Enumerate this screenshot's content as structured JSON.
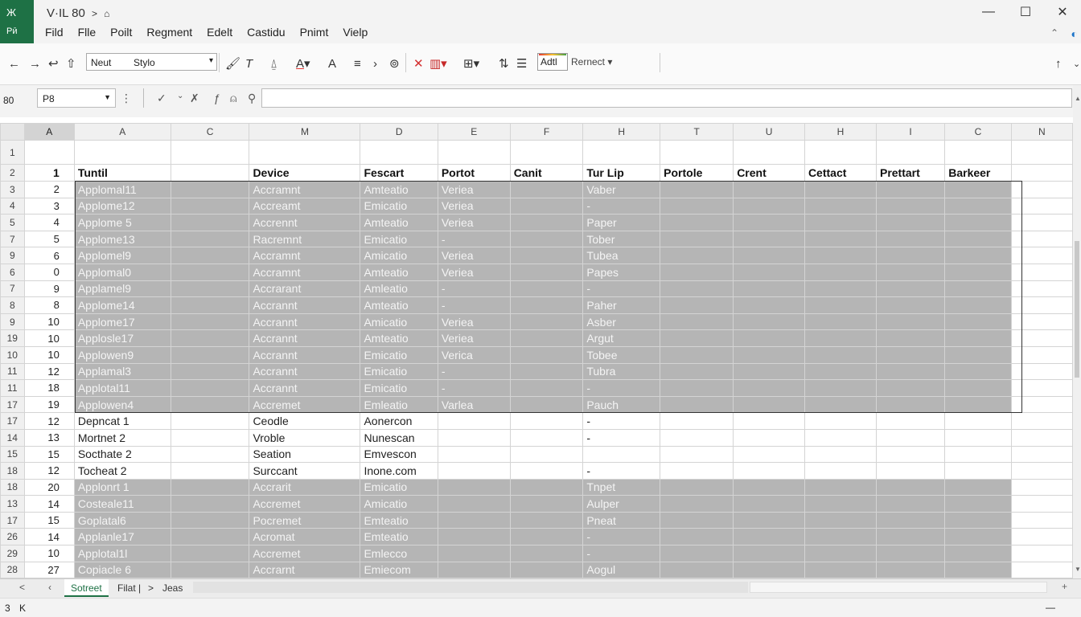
{
  "app": {
    "badge_top": "Ж",
    "badge_bottom": "Рӣ",
    "title": "V·IL 80",
    "title_sep": ">",
    "title_icon": "house-icon"
  },
  "menu": [
    "Fild",
    "Flle",
    "Poilt",
    "Regment",
    "Edelt",
    "Castidu",
    "Pnimt",
    "Vielp"
  ],
  "window_controls": {
    "minimize": "—",
    "maximize": "☐",
    "close": "✕"
  },
  "toolbar": {
    "font_name": "Neut",
    "font_style": "Stylo",
    "style_label": "Adtl",
    "refresh_label": "Rernect"
  },
  "formula_bar": {
    "left_label": "80",
    "name_box": "P8",
    "fx": "ƒ",
    "accept": "✓",
    "cancel": "✗"
  },
  "columns": [
    "A",
    "A",
    "C",
    "M",
    "D",
    "E",
    "F",
    "H",
    "T",
    "U",
    "H",
    "I",
    "C",
    "N"
  ],
  "header_row": {
    "row_label": "2",
    "num": "1",
    "b": "Tuntil",
    "c": "",
    "d": "Device",
    "e": "Fescart",
    "f": "Portot",
    "g": "Canit",
    "h": "Tur Lip",
    "i": "Portole",
    "j": "Crent",
    "k": "Cettact",
    "l": "Prettart",
    "m": "Barkeer"
  },
  "first_row_label": "1",
  "rows": [
    {
      "rl": "3",
      "n": "2",
      "b": "Applomal11",
      "d": "Accramnt",
      "e": "Amteatio",
      "f": "Veriea",
      "h": "Vaber",
      "style": "dark"
    },
    {
      "rl": "4",
      "n": "3",
      "b": "Applome12",
      "d": "Accreamt",
      "e": "Emicatio",
      "f": "Veriea",
      "h": "-",
      "style": "dark"
    },
    {
      "rl": "5",
      "n": "4",
      "b": "Applome 5",
      "d": "Accrennt",
      "e": "Amteatio",
      "f": "Veriea",
      "h": "Paper",
      "style": "dark"
    },
    {
      "rl": "7",
      "n": "5",
      "b": "Applome13",
      "d": "Racremnt",
      "e": "Emicatio",
      "f": "-",
      "h": "Tober",
      "style": "dark"
    },
    {
      "rl": "9",
      "n": "6",
      "b": "Applomel9",
      "d": "Accramnt",
      "e": "Amicatio",
      "f": "Veriea",
      "h": "Tubea",
      "style": "dark"
    },
    {
      "rl": "6",
      "n": "0",
      "b": "Applomal0",
      "d": "Accramnt",
      "e": "Amteatio",
      "f": "Veriea",
      "h": "Papes",
      "style": "dark"
    },
    {
      "rl": "7",
      "n": "9",
      "b": "Applamel9",
      "d": "Accrarant",
      "e": "Amleatio",
      "f": "-",
      "h": "-",
      "style": "dark"
    },
    {
      "rl": "8",
      "n": "8",
      "b": "Applome14",
      "d": "Accrannt",
      "e": "Amteatio",
      "f": "-",
      "h": "Paher",
      "style": "dark"
    },
    {
      "rl": "9",
      "n": "10",
      "b": "Applome17",
      "d": "Accrannt",
      "e": "Amicatio",
      "f": "Veriea",
      "h": "Asber",
      "style": "dark"
    },
    {
      "rl": "19",
      "n": "10",
      "b": "Applosle17",
      "d": "Accrannt",
      "e": "Amteatio",
      "f": "Veriea",
      "h": "Argut",
      "style": "dark"
    },
    {
      "rl": "10",
      "n": "10",
      "b": "Applowen9",
      "d": "Accrannt",
      "e": "Emicatio",
      "f": "Verica",
      "h": "Tobee",
      "style": "dark"
    },
    {
      "rl": "11",
      "n": "12",
      "b": "Applamal3",
      "d": "Accrannt",
      "e": "Emicatio",
      "f": "-",
      "h": "Tubra",
      "style": "dark"
    },
    {
      "rl": "11",
      "n": "18",
      "b": "Applotal11",
      "d": "Accrannt",
      "e": "Emicatio",
      "f": "-",
      "h": "-",
      "style": "dark"
    },
    {
      "rl": "17",
      "n": "19",
      "b": "Applowen4",
      "d": "Accremet",
      "e": "Emleatio",
      "f": "Varlea",
      "h": "Pauch",
      "style": "dark"
    },
    {
      "rl": "17",
      "n": "12",
      "b": "Depncat 1",
      "d": "Ceodle",
      "e": "Aonercon",
      "f": "",
      "h": "-",
      "style": "light"
    },
    {
      "rl": "14",
      "n": "13",
      "b": "Mortnet 2",
      "d": "Vroble",
      "e": "Nunescan",
      "f": "",
      "h": "-",
      "style": "light"
    },
    {
      "rl": "15",
      "n": "15",
      "b": "Socthate 2",
      "d": "Seation",
      "e": "Emvescon",
      "f": "",
      "h": "",
      "style": "light"
    },
    {
      "rl": "18",
      "n": "12",
      "b": "Tocheat 2",
      "d": "Surccant",
      "e": "Inone.com",
      "f": "",
      "h": "-",
      "style": "light"
    },
    {
      "rl": "18",
      "n": "20",
      "b": "Applonrt 1",
      "d": "Accrarit",
      "e": "Emicatio",
      "f": "",
      "h": "Tnpet",
      "style": "dark"
    },
    {
      "rl": "13",
      "n": "14",
      "b": "Costeale11",
      "d": "Accremet",
      "e": "Amicatio",
      "f": "",
      "h": "Aulper",
      "style": "dark"
    },
    {
      "rl": "17",
      "n": "15",
      "b": "Goplatal6",
      "d": "Pocremet",
      "e": "Emteatio",
      "f": "",
      "h": "Pneat",
      "style": "dark"
    },
    {
      "rl": "26",
      "n": "14",
      "b": "Applanle17",
      "d": "Acromat",
      "e": "Emteatio",
      "f": "",
      "h": "-",
      "style": "dark"
    },
    {
      "rl": "29",
      "n": "10",
      "b": "Applotal1l",
      "d": "Accremet",
      "e": "Emlecco",
      "f": "",
      "h": "-",
      "style": "dark"
    },
    {
      "rl": "28",
      "n": "27",
      "b": "Copiacle 6",
      "d": "Accrarnt",
      "e": "Emiecom",
      "f": "",
      "h": "Aogul",
      "style": "dark"
    }
  ],
  "sheet_tabs": {
    "nav_prev": "<",
    "nav_next": "K",
    "active": "Sotreet",
    "second": "Filat |",
    "sep": ">",
    "third": "Jeas",
    "add": "+"
  },
  "status_bar": {
    "left1": "3",
    "left2": "K",
    "right": "—"
  }
}
